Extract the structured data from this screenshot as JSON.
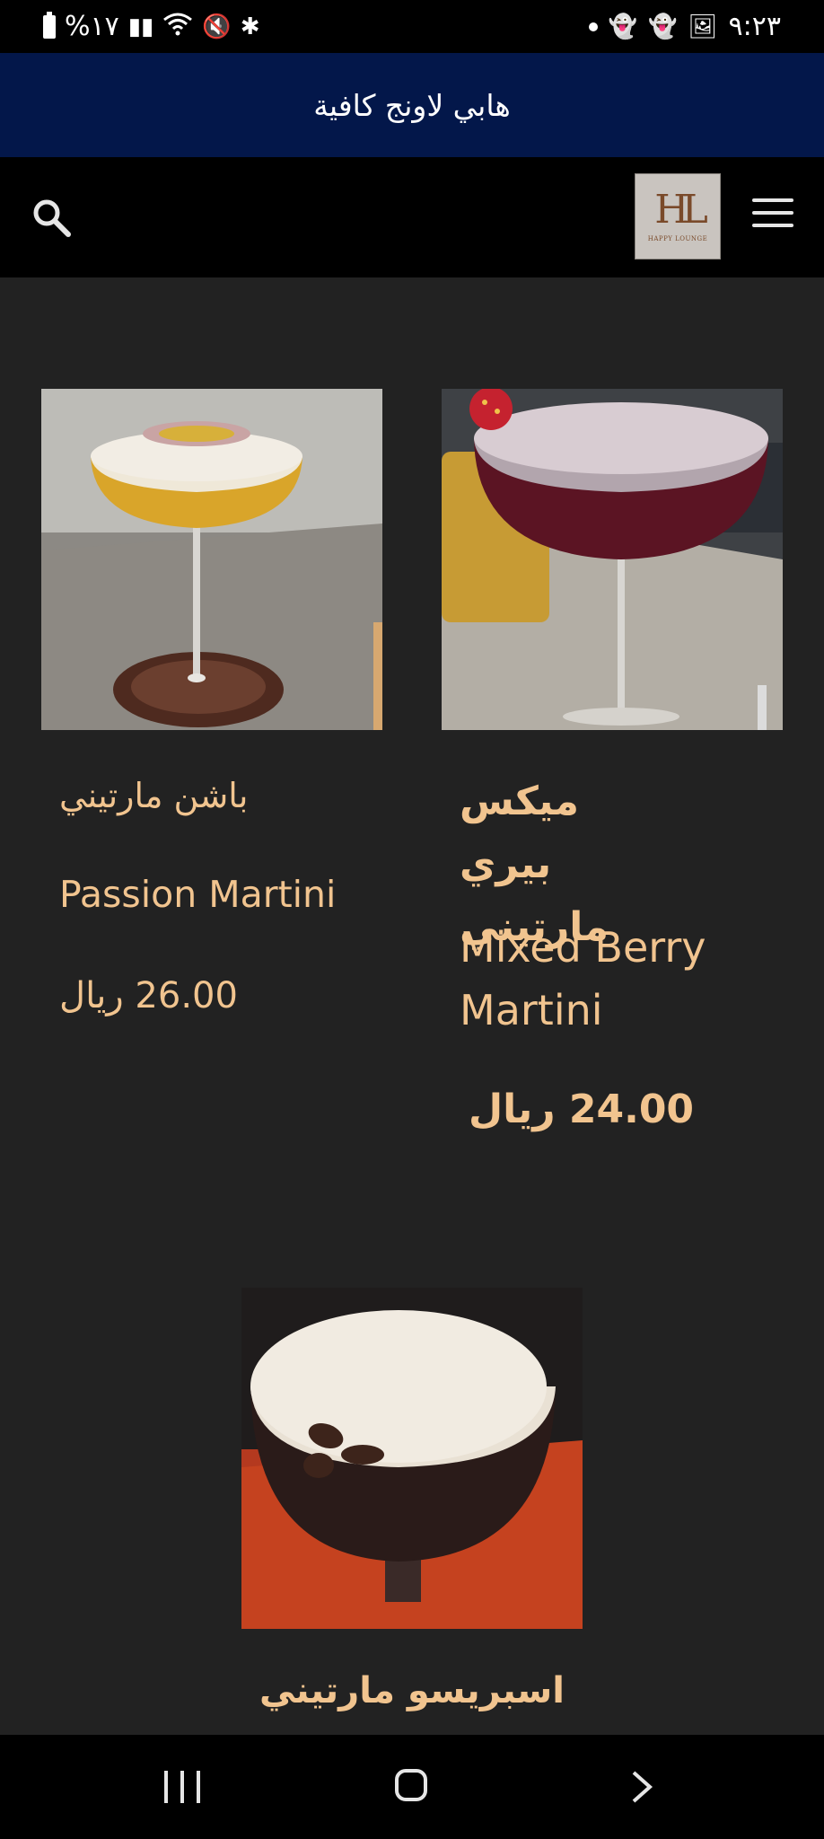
{
  "status_bar": {
    "battery_text": "%١٧",
    "time": "٩:٢٣"
  },
  "banner": {
    "title": "هابي لاونج كافية"
  },
  "header": {
    "logo_mark": "HL",
    "logo_subtitle": "HAPPY LOUNGE"
  },
  "products": [
    {
      "name_ar": "باشن مارتيني",
      "name_en": "Passion Martini",
      "price": "26.00 ريال"
    },
    {
      "name_ar": "ميكس بيري مارتيني",
      "name_en": "Mixed Berry Martini",
      "price": "24.00 ريال"
    },
    {
      "name_ar": "اسبريسو مارتيني"
    }
  ],
  "icons": {
    "search": "search-icon",
    "menu": "hamburger-menu-icon",
    "nav_recent": "recent-apps-icon",
    "nav_home": "home-icon",
    "nav_back": "back-icon"
  },
  "colors": {
    "banner": "#03174a",
    "background": "#222222",
    "accent_text": "#f1c48f"
  }
}
